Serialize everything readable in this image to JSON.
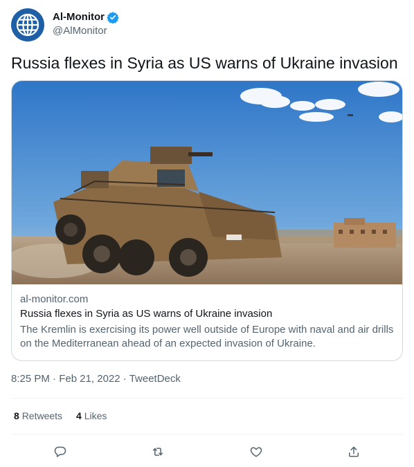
{
  "author": {
    "display_name": "Al-Monitor",
    "handle": "@AlMonitor",
    "verified": true,
    "avatar_icon": "globe-icon",
    "avatar_color": "#1e5fa5"
  },
  "tweet": {
    "text": "Russia flexes in Syria as US warns of Ukraine invasion"
  },
  "card": {
    "image_icon": "armored-vehicle-photo",
    "domain": "al-monitor.com",
    "title": "Russia flexes in Syria as US warns of Ukraine invasion",
    "description": "The Kremlin is exercising its power well outside of Europe with naval and air drills on the Mediterranean ahead of an expected invasion of Ukraine."
  },
  "meta": {
    "time": "8:25 PM",
    "date": "Feb 21, 2022",
    "source": "TweetDeck",
    "separator": "·"
  },
  "stats": {
    "retweets_count": "8",
    "retweets_label": "Retweets",
    "likes_count": "4",
    "likes_label": "Likes"
  },
  "actions": [
    {
      "name": "reply",
      "icon": "reply-icon"
    },
    {
      "name": "retweet",
      "icon": "retweet-icon"
    },
    {
      "name": "like",
      "icon": "heart-icon"
    },
    {
      "name": "share",
      "icon": "share-icon"
    }
  ],
  "colors": {
    "verified_badge": "#1d9bf0",
    "secondary_text": "#536471",
    "border": "#cfd9de"
  }
}
